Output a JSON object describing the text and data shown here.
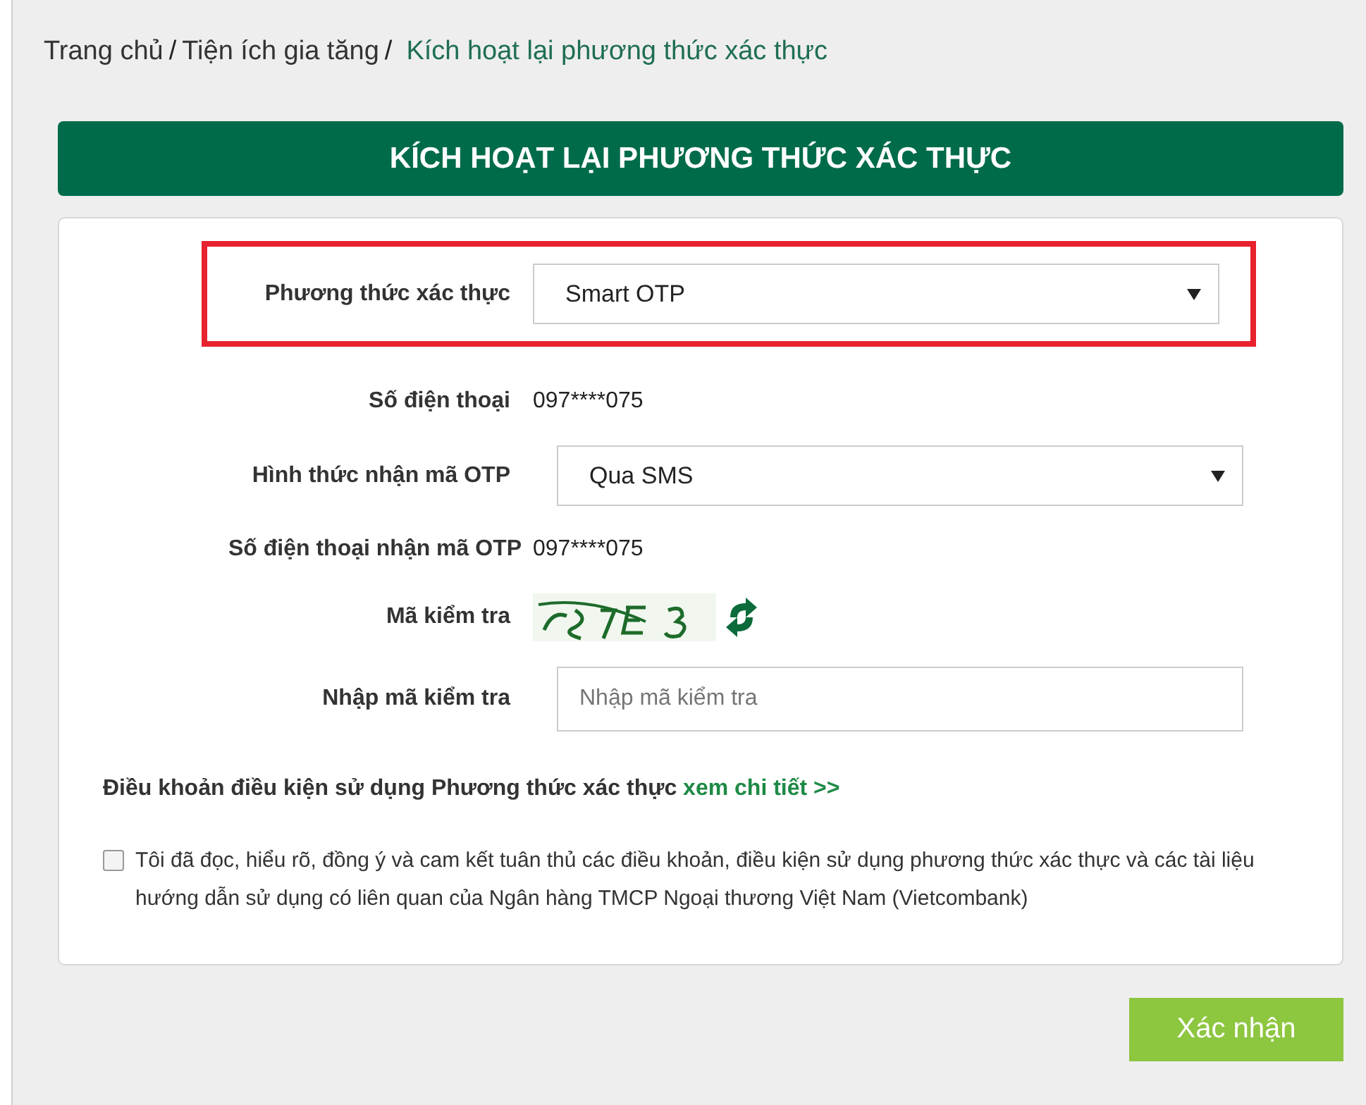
{
  "breadcrumb": [
    {
      "label": "Trang chủ",
      "current": false,
      "separator": "/"
    },
    {
      "label": "Tiện ích gia tăng",
      "current": false,
      "separator": "/"
    },
    {
      "label": "Kích hoạt lại phương thức xác thực",
      "current": true
    }
  ],
  "header": {
    "title": "KÍCH HOẠT LẠI PHƯƠNG THỨC XÁC THỰC"
  },
  "form": {
    "fields": [
      {
        "kind": "select",
        "label": "Phương thức xác thực",
        "value": "Smart OTP",
        "highlighted": true
      },
      {
        "kind": "text",
        "label": "Số điện thoại",
        "value": "097****075",
        "highlighted": false
      },
      {
        "kind": "select",
        "label": "Hình thức nhận mã OTP",
        "value": "Qua SMS",
        "highlighted": false
      },
      {
        "kind": "text",
        "label": "Số điện thoại nhận mã OTP",
        "value": "097****075",
        "highlighted": false
      },
      {
        "kind": "captcha",
        "label": "Mã kiểm tra",
        "highlighted": false
      },
      {
        "kind": "input",
        "label": "Nhập mã kiểm tra",
        "placeholder": "Nhập mã kiểm tra",
        "highlighted": false
      }
    ],
    "terms": {
      "text": "Điều khoản điều kiện sử dụng Phương thức xác thực",
      "link": "xem chi tiết >>"
    },
    "agreement": {
      "checked": false,
      "text": "Tôi đã đọc, hiểu rõ, đồng ý và cam kết tuân thủ các điều khoản, điều kiện sử dụng phương thức xác thực và các tài liệu hướng dẫn sử dụng có liên quan của Ngân hàng TMCP Ngoại thương Việt Nam (Vietcombank)"
    }
  },
  "buttons": [
    "Xác nhận"
  ]
}
